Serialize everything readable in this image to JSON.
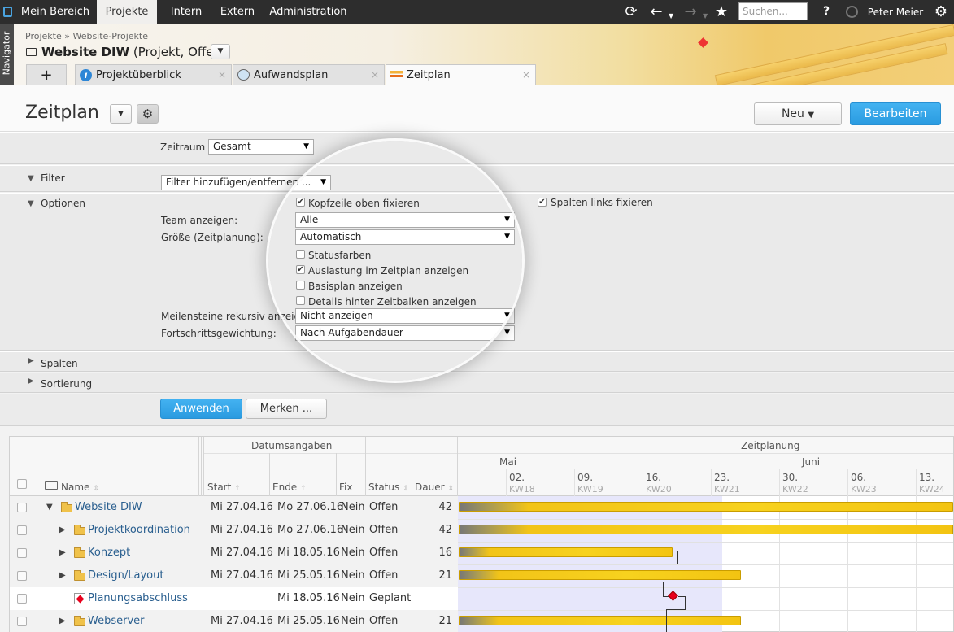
{
  "topnav": {
    "tabs": [
      "Mein Bereich",
      "Projekte",
      "Intern",
      "Extern",
      "Administration"
    ],
    "active_tab": "Projekte",
    "search_placeholder": "Suchen...",
    "help": "?",
    "user": "Peter Meier",
    "icons": [
      "app-logo-icon",
      "refresh-icon",
      "back-icon",
      "forward-icon",
      "star-icon",
      "help-icon",
      "timer-icon",
      "gear-icon"
    ]
  },
  "navigator_label": "Navigator",
  "breadcrumb": [
    "Projekte",
    "Website-Projekte"
  ],
  "project": {
    "title": "Website DIW",
    "subtitle": "(Projekt, Offen)"
  },
  "tabs": {
    "add": "+",
    "items": [
      "Projektüberblick",
      "Aufwandsplan",
      "Zeitplan"
    ],
    "active": "Zeitplan",
    "close": "×"
  },
  "page": {
    "title": "Zeitplan",
    "new_button": "Neu",
    "edit_button": "Bearbeiten"
  },
  "zeitraum": {
    "label": "Zeitraum",
    "value": "Gesamt"
  },
  "filter": {
    "label": "Filter",
    "value": "Filter hinzufügen/entfernen ..."
  },
  "optionen": {
    "label": "Optionen",
    "kopfzeile": "Kopfzeile oben fixieren",
    "kopfzeile_checked": true,
    "spalten_links": "Spalten links fixieren",
    "spalten_links_checked": true,
    "team_label": "Team anzeigen:",
    "team_value": "Alle",
    "groesse_label": "Größe (Zeitplanung):",
    "groesse_value": "Automatisch",
    "statusfarben": "Statusfarben",
    "auslastung": "Auslastung im Zeitplan anzeigen",
    "basisplan": "Basisplan anzeigen",
    "details": "Details hinter Zeitbalken anzeigen",
    "meilensteine_label": "Meilensteine rekursiv anzeigen:",
    "meilensteine_value": "Nicht anzeigen",
    "fortschritt_label": "Fortschrittsgewichtung:",
    "fortschritt_value": "Nach Aufgabendauer"
  },
  "spalten": "Spalten",
  "sortierung": "Sortierung",
  "actions": {
    "apply": "Anwenden",
    "remember": "Merken ..."
  },
  "grid": {
    "group_dates": "Datumsangaben",
    "group_plan": "Zeitplanung",
    "columns": [
      "Name",
      "Start",
      "Ende",
      "Fix",
      "Status",
      "Dauer"
    ],
    "months": [
      "Mai",
      "Juni"
    ],
    "weeks": [
      {
        "date": "02.",
        "kw": "KW18"
      },
      {
        "date": "09.",
        "kw": "KW19"
      },
      {
        "date": "16.",
        "kw": "KW20"
      },
      {
        "date": "23.",
        "kw": "KW21"
      },
      {
        "date": "30.",
        "kw": "KW22"
      },
      {
        "date": "06.",
        "kw": "KW23"
      },
      {
        "date": "13.",
        "kw": "KW24"
      }
    ],
    "rows": [
      {
        "name": "Website DIW",
        "start": "Mi 27.04.16",
        "end": "Mo 27.06.16",
        "fix": "Nein",
        "status": "Offen",
        "duration": "42"
      },
      {
        "name": "Projektkoordination",
        "start": "Mi 27.04.16",
        "end": "Mo 27.06.16",
        "fix": "Nein",
        "status": "Offen",
        "duration": "42"
      },
      {
        "name": "Konzept",
        "start": "Mi 27.04.16",
        "end": "Mi 18.05.16",
        "fix": "Nein",
        "status": "Offen",
        "duration": "16"
      },
      {
        "name": "Design/Layout",
        "start": "Mi 27.04.16",
        "end": "Mi 25.05.16",
        "fix": "Nein",
        "status": "Offen",
        "duration": "21"
      },
      {
        "name": "Planungsabschluss",
        "start": "",
        "end": "Mi 18.05.16",
        "fix": "Nein",
        "status": "Geplant",
        "duration": ""
      },
      {
        "name": "Webserver",
        "start": "Mi 27.04.16",
        "end": "Mi 25.05.16",
        "fix": "Nein",
        "status": "Offen",
        "duration": "21"
      }
    ]
  }
}
